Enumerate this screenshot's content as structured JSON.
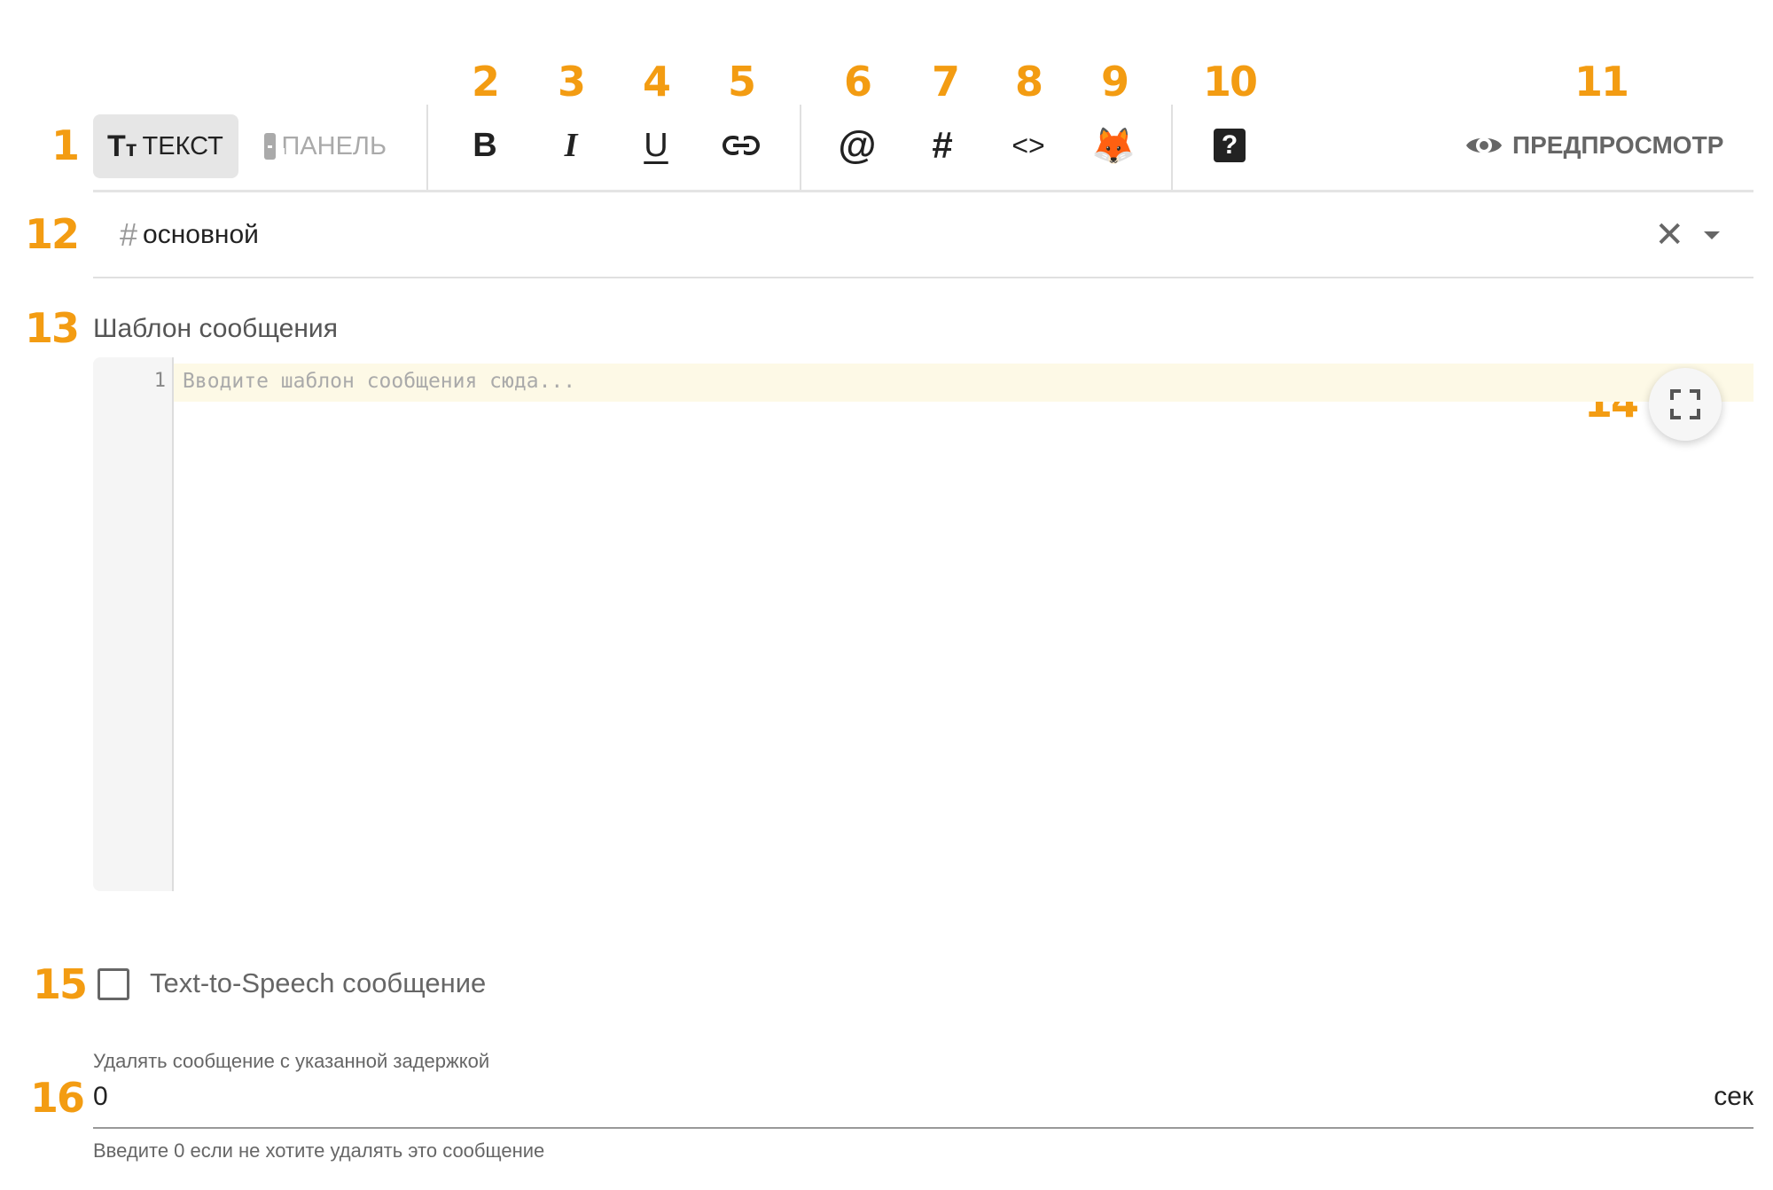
{
  "annotations": [
    "1",
    "2",
    "3",
    "4",
    "5",
    "6",
    "7",
    "8",
    "9",
    "10",
    "11",
    "12",
    "13",
    "14",
    "15",
    "16"
  ],
  "toolbar": {
    "mode_text_label": "ТЕКСТ",
    "mode_panel_label": "ПАНЕЛЬ",
    "preview_label": "ПРЕДПРОСМОТР",
    "bold_glyph": "B",
    "italic_glyph": "I",
    "underline_glyph": "U",
    "mention_glyph": "@",
    "channel_glyph": "#",
    "code_glyph": "<>",
    "emoji_glyph": "🦊",
    "help_glyph": "?"
  },
  "channel": {
    "prefix": "#",
    "value": "основной"
  },
  "editor": {
    "label": "Шаблон сообщения",
    "line_number": "1",
    "placeholder": "Вводите шаблон сообщения сюда..."
  },
  "tts": {
    "label": "Text-to-Speech сообщение",
    "checked": false
  },
  "delete_delay": {
    "label": "Удалять сообщение с указанной задержкой",
    "value": "0",
    "unit": "сек",
    "hint": "Введите 0 если не хотите удалять это сообщение"
  },
  "colors": {
    "annotation": "#f39c12",
    "active_line": "#fdf9e6",
    "gutter": "#f5f5f5"
  }
}
